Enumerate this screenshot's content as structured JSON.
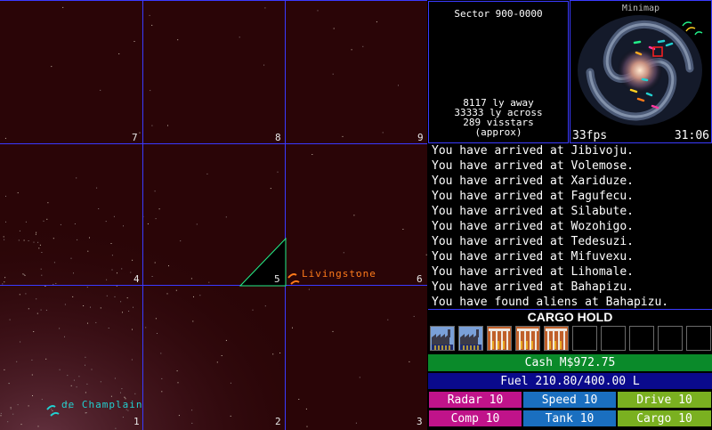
{
  "sector": {
    "title": "Sector 900-0000",
    "distance": "8117 ly away",
    "across": "33333 ly across",
    "visstars": "289 visstars",
    "approx": "(approx)"
  },
  "grid_labels": [
    "7",
    "8",
    "9",
    "4",
    "5",
    "6",
    "1",
    "2",
    "3"
  ],
  "nav": {
    "livingstone": "Livingstone",
    "champlain": "de Champlain"
  },
  "minimap": {
    "title": "Minimap",
    "fps": "33fps",
    "clock": "31:06"
  },
  "log": [
    "You have arrived at Jibivoju.",
    "You have arrived at Volemose.",
    "You have arrived at Xariduze.",
    "You have arrived at Fagufecu.",
    "You have arrived at Silabute.",
    "You have arrived at Wozohigo.",
    "You have arrived at Tedesuzi.",
    "You have arrived at Mifuvexu.",
    "You have arrived at Lihomale.",
    "You have arrived at Bahapizu.",
    "You have found aliens at Bahapizu."
  ],
  "cargo": {
    "title": "CARGO HOLD",
    "slots": [
      "factory",
      "factory",
      "crops",
      "crops",
      "crops",
      "empty",
      "empty",
      "empty",
      "empty",
      "empty"
    ]
  },
  "cash": "Cash M$972.75",
  "fuel": "Fuel 210.80/400.00 L",
  "upgrades": {
    "radar": "Radar 10",
    "speed": "Speed 10",
    "drive": "Drive 10",
    "comp": "Comp 10",
    "tank": "Tank 10",
    "cargo": "Cargo 10"
  },
  "colors": {
    "grid": "#3a3aff",
    "map_bg": "#2a0507",
    "ship": "#22ee88",
    "livingstone": "#ff7a1a",
    "champlain": "#22d0d0",
    "cash": "#0a8a2a",
    "fuel": "#0a0a8c",
    "magenta": "#c0138a",
    "blue": "#1a6fc0",
    "green": "#7ab020"
  }
}
